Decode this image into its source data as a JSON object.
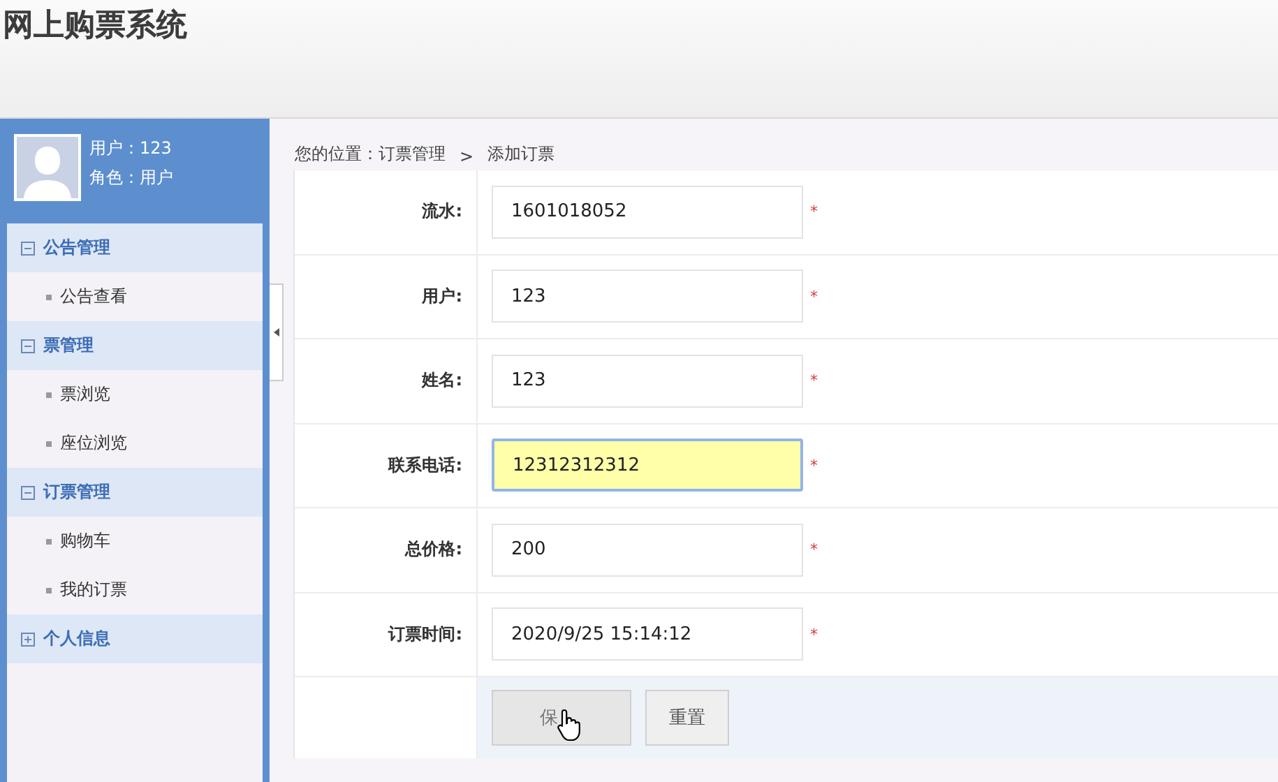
{
  "app_title": "网上购票系统",
  "user": {
    "name_line": "用户：123",
    "role_line": "角色：用户"
  },
  "menu": [
    {
      "label": "公告管理",
      "expanded": true,
      "children": [
        {
          "label": "公告查看"
        }
      ]
    },
    {
      "label": "票管理",
      "expanded": true,
      "children": [
        {
          "label": "票浏览"
        },
        {
          "label": "座位浏览"
        }
      ]
    },
    {
      "label": "订票管理",
      "expanded": true,
      "children": [
        {
          "label": "购物车"
        },
        {
          "label": "我的订票"
        }
      ]
    },
    {
      "label": "个人信息",
      "expanded": false
    }
  ],
  "breadcrumb": [
    {
      "text": "您的位置：订票管理"
    },
    {
      "text": ">"
    },
    {
      "text": "添加订票"
    }
  ],
  "fields": [
    {
      "label": "流水:",
      "value": "1601018052",
      "mark": "*",
      "focused": false
    },
    {
      "label": "用户:",
      "value": "123",
      "mark": "*",
      "focused": false
    },
    {
      "label": "姓名:",
      "value": "123",
      "mark": "*",
      "focused": false
    },
    {
      "label": "联系电话:",
      "value": "12312312312",
      "mark": "*",
      "focused": true
    },
    {
      "label": "总价格:",
      "value": "200",
      "mark": "*",
      "focused": false
    },
    {
      "label": "订票时间:",
      "value": "2020/9/25 15:14:12",
      "mark": "*",
      "focused": false
    }
  ],
  "buttons": [
    {
      "label": "保",
      "kind": "save"
    },
    {
      "label": "重置",
      "kind": "reset"
    }
  ]
}
